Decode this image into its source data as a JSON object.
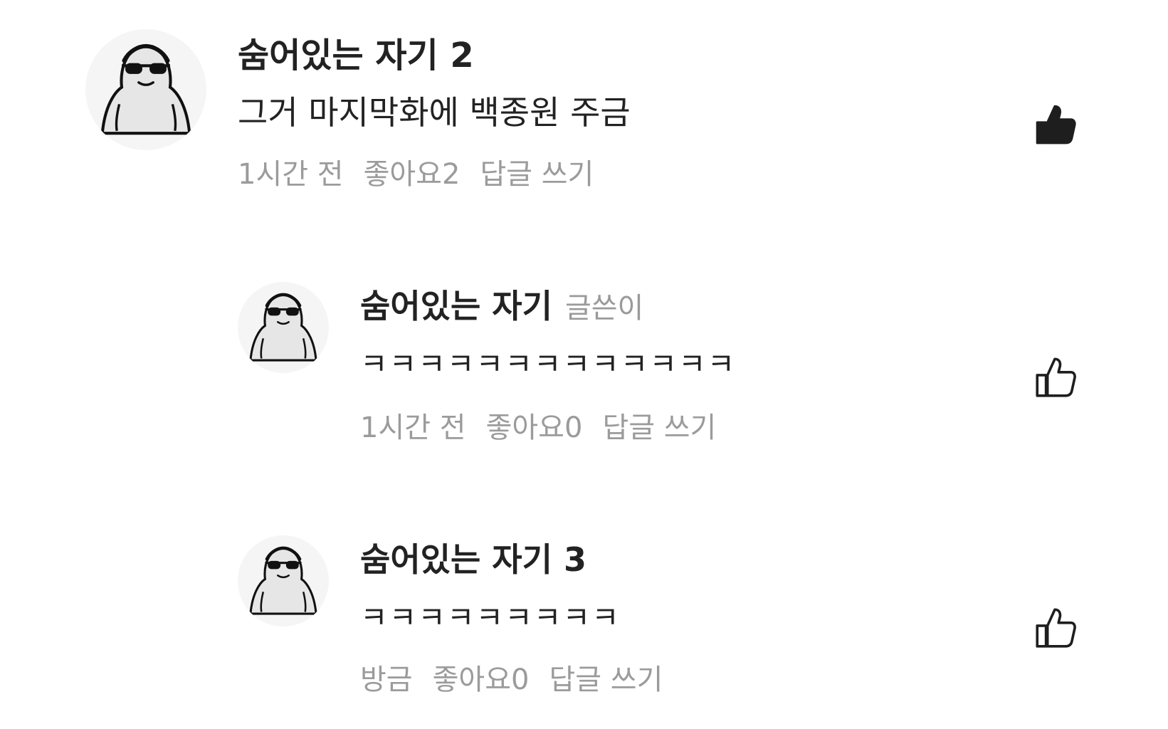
{
  "comments": [
    {
      "author": "숨어있는 자기 2",
      "badge": "",
      "text": "그거 마지막화에 백종원 주금",
      "time": "1시간 전",
      "likes_label": "좋아요2",
      "reply_label": "답글 쓰기",
      "liked": true,
      "avatar_icon": "sunglasses-ghost-avatar"
    },
    {
      "author": "숨어있는 자기",
      "badge": "글쓴이",
      "text": "ㅋㅋㅋㅋㅋㅋㅋㅋㅋㅋㅋㅋㅋ",
      "time": "1시간 전",
      "likes_label": "좋아요0",
      "reply_label": "답글 쓰기",
      "liked": false,
      "avatar_icon": "sunglasses-ghost-avatar"
    },
    {
      "author": "숨어있는 자기 3",
      "badge": "",
      "text": "ㅋㅋㅋㅋㅋㅋㅋㅋㅋ",
      "time": "방금",
      "likes_label": "좋아요0",
      "reply_label": "답글 쓰기",
      "liked": false,
      "avatar_icon": "sunglasses-ghost-avatar"
    }
  ],
  "colors": {
    "text_primary": "#222222",
    "text_secondary": "#9b9b9b",
    "avatar_bg": "#f5f5f5",
    "avatar_body": "#e6e6e6",
    "icon": "#1e1e1e"
  }
}
